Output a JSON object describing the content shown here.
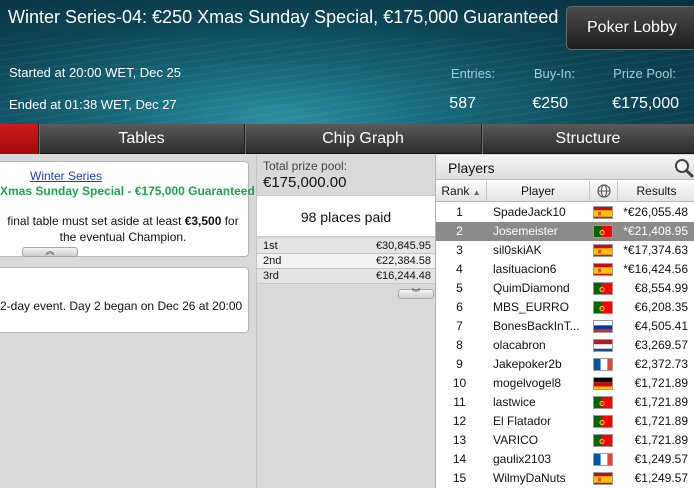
{
  "header": {
    "title": "Winter Series-04: €250 Xmas Sunday Special, €175,000 Guaranteed",
    "lobby_button": "Poker Lobby",
    "started": "Started at 20:00 WET, Dec 25",
    "ended": "Ended at 01:38 WET, Dec 27",
    "entries_label": "Entries:",
    "entries_value": "587",
    "buyin_label": "Buy-In:",
    "buyin_value": "€250",
    "prizepool_label": "Prize Pool:",
    "prizepool_value": "€175,000"
  },
  "tabs": [
    "Tables",
    "Chip Graph",
    "Structure"
  ],
  "left": {
    "series_link": "Winter Series",
    "special_name": "Xmas Sunday Special",
    "special_dash": " - ",
    "special_guarantee": "€175,000 Guaranteed",
    "req_pre": "final table must set aside at least ",
    "req_amount": "€3,500",
    "req_post": " for the eventual Champion.",
    "day_info": "2-day event. Day 2 began on Dec 26 at 20:00"
  },
  "middle": {
    "total_label": "Total prize pool:",
    "total_value": "€175,000.00",
    "places_paid": "98 places paid",
    "prizes": [
      {
        "place": "1st",
        "amount": "€30,845.95"
      },
      {
        "place": "2nd",
        "amount": "€22,384.58"
      },
      {
        "place": "3rd",
        "amount": "€16,244.48"
      }
    ]
  },
  "players": {
    "title": "Players",
    "col_rank": "Rank",
    "col_player": "Player",
    "col_results": "Results",
    "selected_rank": 2,
    "rows": [
      {
        "rank": "1",
        "name": "SpadeJack10",
        "flag": "es",
        "result": "*€26,055.48"
      },
      {
        "rank": "2",
        "name": "Josemeister",
        "flag": "pt",
        "result": "*€21,408.95"
      },
      {
        "rank": "3",
        "name": "sil0skiAK",
        "flag": "es",
        "result": "*€17,374.63"
      },
      {
        "rank": "4",
        "name": "lasituacion6",
        "flag": "es",
        "result": "*€16,424.56"
      },
      {
        "rank": "5",
        "name": "QuimDiamond",
        "flag": "pt",
        "result": "€8,554.99"
      },
      {
        "rank": "6",
        "name": "MBS_EURRO",
        "flag": "pt",
        "result": "€6,208.35"
      },
      {
        "rank": "7",
        "name": "BonesBackInT...",
        "flag": "ru",
        "result": "€4,505.41"
      },
      {
        "rank": "8",
        "name": "olacabron",
        "flag": "nl",
        "result": "€3,269.57"
      },
      {
        "rank": "9",
        "name": "Jakepoker2b",
        "flag": "fr",
        "result": "€2,372.73"
      },
      {
        "rank": "10",
        "name": "mogelvogel8",
        "flag": "de",
        "result": "€1,721.89"
      },
      {
        "rank": "11",
        "name": "lastwice",
        "flag": "pt",
        "result": "€1,721.89"
      },
      {
        "rank": "12",
        "name": "El Flatador",
        "flag": "pt",
        "result": "€1,721.89"
      },
      {
        "rank": "13",
        "name": "VARICO",
        "flag": "pt",
        "result": "€1,721.89"
      },
      {
        "rank": "14",
        "name": "gaulix2103",
        "flag": "fr",
        "result": "€1,249.57"
      },
      {
        "rank": "15",
        "name": "WilmyDaNuts",
        "flag": "es",
        "result": "€1,249.57"
      }
    ]
  },
  "colors": {
    "series_link": "#1a3dcc",
    "special_green": "#1aa64a",
    "selected_row": "#8a8a8a",
    "tab_red": "#c21414"
  },
  "icons": [
    "search-icon",
    "globe-icon",
    "sort-asc-icon",
    "chevron-up-icon",
    "chevron-down-icon"
  ]
}
